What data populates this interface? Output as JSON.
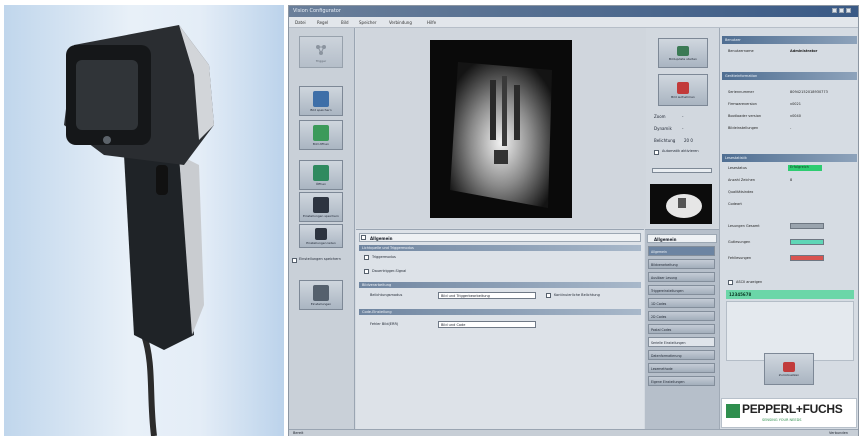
{
  "colors": {
    "status_green": "#2ecc71",
    "counter_gray": "#9aa4ae",
    "counter_teal": "#5fd6b6",
    "counter_red": "#d9534f",
    "result_bar": "#6bd6a8"
  },
  "window": {
    "title": "Vision Configurator"
  },
  "menubar": {
    "items": [
      "Datei",
      "Regel",
      "Bild",
      "Speicher",
      "Verbindung",
      "Hilfe"
    ]
  },
  "toolbar_left": {
    "items": [
      {
        "label": "Trigger",
        "icon": "network-icon"
      },
      {
        "label": "Bild speichern",
        "icon": "save-icon"
      },
      {
        "label": "Bild öffnen",
        "icon": "folder-image-icon"
      },
      {
        "label": "Öffnen",
        "icon": "download-icon"
      },
      {
        "label": "Einstellungen speichern",
        "icon": "settings-save-icon"
      },
      {
        "label": "Einstellungen laden",
        "icon": "settings-load-icon"
      },
      {
        "label": "Einstellungen",
        "icon": "camera-icon"
      }
    ],
    "checkbox_label": "Einstellungen speichern"
  },
  "camera_controls": {
    "button1": "Bildupdate starten",
    "button2": "Bild aufnehmen",
    "zoom_label": "Zoom",
    "zoom_value": "-",
    "dynamic_label": "Dynamik",
    "dynamic_value": "-",
    "exposure_label": "Belichtung",
    "exposure_value": "20 0",
    "auto_label": "Automatik aktivieren"
  },
  "right_panel": {
    "sec_user": "Benutzer",
    "user_label": "Benutzername",
    "user_value": "Administrator",
    "sec_device": "Geräteinformation",
    "device_rows": [
      {
        "label": "Seriennummer",
        "value": "80942152018930773"
      },
      {
        "label": "Firmwareversion",
        "value": "v0021"
      },
      {
        "label": "Bootloader version",
        "value": "v0040"
      },
      {
        "label": "Bildeinstellungen",
        "value": "-"
      }
    ],
    "sec_result": "Lesestatistik",
    "result_rows": [
      {
        "label": "Lesestatus",
        "value": "Erfolgreich"
      },
      {
        "label": "Anzahl Zeichen",
        "value": "8"
      },
      {
        "label": "Qualitätsindex",
        "value": ""
      },
      {
        "label": "Codeart",
        "value": ""
      }
    ],
    "counter_rows": [
      {
        "label": "Lesungen Gesamt"
      },
      {
        "label": "Gutlesungen"
      },
      {
        "label": "Fehllesungen"
      }
    ],
    "ascii_label": "ASCII anzeigen",
    "result_text": "12345678",
    "reset_button": "Zurücksetzen",
    "logo_text": "PEPPERL+FUCHS",
    "logo_sub": "SENSING YOUR NEEDS"
  },
  "settings_panel": {
    "header": "Allgemein",
    "group1": "Lichtquelle und Triggermodus",
    "opt1": "Triggermodus",
    "opt2": "Dauertrigger-Signal",
    "group2": "Bildverarbeitung",
    "combo1_label": "Belichtungsmodus",
    "combo1_value": "Bild und Triggerbearbeitung",
    "check_label": "Kontinuierliche Belichtung",
    "group3": "Code-Einstellung",
    "combo2_label": "Fehler Bild(ERR)",
    "combo2_value": "Bild und Code"
  },
  "tabs": {
    "header": "Allgemein",
    "items": [
      "Allgemein",
      "Bildverarbeitung",
      "Auslöser Lesung",
      "Triggereinstellungen",
      "1D Codes",
      "2D Codes",
      "Postal Codes",
      "Serielle Einstellungen",
      "Datenformatierung",
      "Lesemethode",
      "Eigene Einstellungen"
    ]
  },
  "statusbar": {
    "left": "Bereit",
    "right": "Verbunden"
  }
}
